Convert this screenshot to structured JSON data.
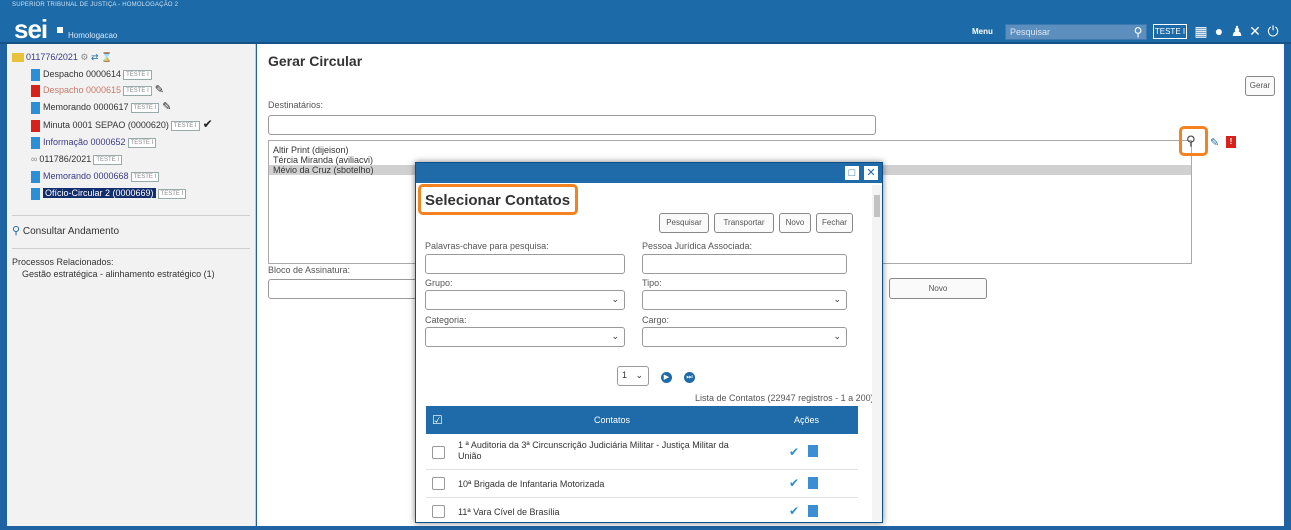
{
  "header": {
    "top_text": "SUPERIOR TRIBUNAL DE JUSTIÇA - HOMOLOGAÇÃO 2",
    "logo": "sei",
    "env": "Homologacao",
    "menu_label": "Menu",
    "search_placeholder": "Pesquisar",
    "user_badge": "TESTE I"
  },
  "tree": {
    "process_number": "011776/2021",
    "items": [
      {
        "label": "Despacho 0000614",
        "badge": "TESTE I"
      },
      {
        "label": "Despacho 0000615",
        "badge": "TESTE I"
      },
      {
        "label": "Memorando 0000617",
        "badge": "TESTE I"
      },
      {
        "label": "Minuta 0001 SEPAO (0000620)",
        "badge": "TESTE I"
      },
      {
        "label": "Informação 0000652",
        "badge": "TESTE I"
      },
      {
        "label": "011786/2021",
        "badge": "TESTE I"
      },
      {
        "label": "Memorando 0000668",
        "badge": "TESTE I"
      },
      {
        "label": "Ofício-Circular 2 (0000669)",
        "badge": "TESTE I"
      }
    ],
    "consultar": "Consultar Andamento",
    "related_title": "Processos Relacionados:",
    "related_item": "Gestão estratégica - alinhamento estratégico (1)"
  },
  "main": {
    "title": "Gerar Circular",
    "gerar_button": "Gerar",
    "destinatarios_label": "Destinatários:",
    "destinatarios": [
      "Altir Print (dijeison)",
      "Tércia Miranda (aviliacvi)",
      "Mévio da Cruz (sbotelho)"
    ],
    "bloco_label": "Bloco de Assinatura:",
    "novo_button": "Novo"
  },
  "modal": {
    "title": "Selecionar Contatos",
    "buttons": {
      "pesquisar": "Pesquisar",
      "transportar": "Transportar",
      "novo": "Novo",
      "fechar": "Fechar"
    },
    "labels": {
      "palavras": "Palavras-chave para pesquisa:",
      "pessoa": "Pessoa Jurídica Associada:",
      "grupo": "Grupo:",
      "tipo": "Tipo:",
      "categoria": "Categoria:",
      "cargo": "Cargo:"
    },
    "page_select": "1",
    "list_caption": "Lista de Contatos (22947 registros - 1 a 200):",
    "col_contatos": "Contatos",
    "col_acoes": "Ações",
    "rows": [
      {
        "line1": "1 ª Auditoria da 3ª Circunscrição Judiciária Militar - Justiça Militar da",
        "line2": "União"
      },
      {
        "line1": "10ª Brigada de Infantaria Motorizada",
        "line2": ""
      },
      {
        "line1": "11ª Vara Cível de Brasília",
        "line2": ""
      }
    ]
  }
}
